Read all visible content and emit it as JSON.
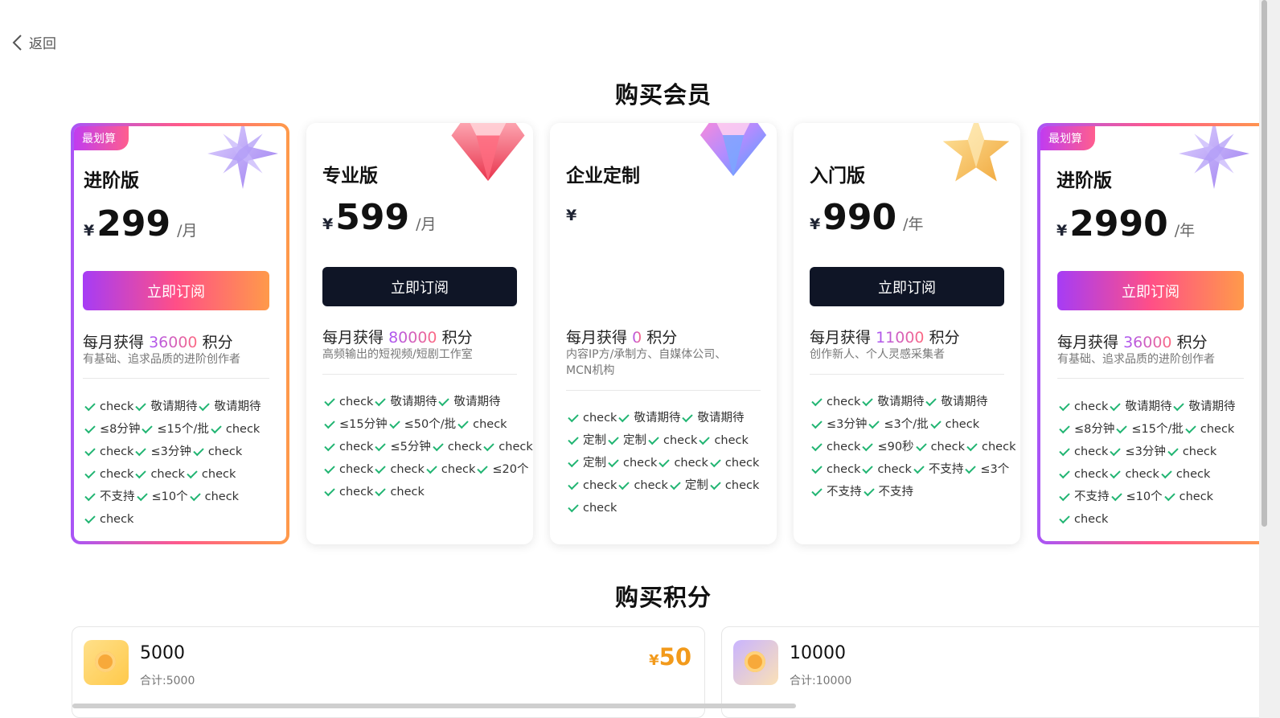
{
  "nav": {
    "back_label": "返回"
  },
  "membership": {
    "title": "购买会员",
    "plans": [
      {
        "tag": "最划算",
        "name": "进阶版",
        "currency": "¥",
        "amount": "299",
        "period": "/月",
        "button_label": "立即订阅",
        "credits_prefix": "每月获得",
        "credits": "36000",
        "credits_suffix": "积分",
        "description": [
          "有基础、追求品质的进阶创作者"
        ],
        "features": [
          [
            "check",
            "敬请期待",
            "敬请期待"
          ],
          [
            "≤8分钟",
            "≤15个/批",
            "check"
          ],
          [
            "check",
            "≤3分钟",
            "check"
          ],
          [
            "check",
            "check",
            "check"
          ],
          [
            "不支持",
            "≤10个",
            "check"
          ],
          [
            "check"
          ]
        ],
        "icon": "purple-star-icon",
        "highlight": true
      },
      {
        "name": "专业版",
        "currency": "¥",
        "amount": "599",
        "period": "/月",
        "button_label": "立即订阅",
        "credits_prefix": "每月获得",
        "credits": "80000",
        "credits_suffix": "积分",
        "description": [
          "高频输出的短视频/短剧工作室"
        ],
        "features": [
          [
            "check",
            "敬请期待",
            "敬请期待"
          ],
          [
            "≤15分钟",
            "≤50个/批",
            "check"
          ],
          [
            "check",
            "≤5分钟",
            "check",
            "check"
          ],
          [
            "check",
            "check",
            "check",
            "≤20个"
          ],
          [
            "check",
            "check"
          ]
        ],
        "icon": "red-gem-icon",
        "highlight": false
      },
      {
        "name": "企业定制",
        "currency": "¥",
        "amount": "",
        "period": "",
        "button_label": "",
        "credits_prefix": "每月获得",
        "credits": "0",
        "credits_suffix": "积分",
        "description": [
          "内容IP方/承制方、自媒体公司、",
          "MCN机构"
        ],
        "features": [
          [
            "check",
            "敬请期待",
            "敬请期待"
          ],
          [
            "定制",
            "定制",
            "check",
            "check"
          ],
          [
            "定制",
            "check",
            "check",
            "check"
          ],
          [
            "check",
            "check",
            "定制",
            "check"
          ],
          [
            "check"
          ]
        ],
        "icon": "blue-gem-icon",
        "highlight": false
      },
      {
        "name": "入门版",
        "currency": "¥",
        "amount": "990",
        "period": "/年",
        "button_label": "立即订阅",
        "credits_prefix": "每月获得",
        "credits": "11000",
        "credits_suffix": "积分",
        "description": [
          "创作新人、个人灵感采集者"
        ],
        "features": [
          [
            "check",
            "敬请期待",
            "敬请期待"
          ],
          [
            "≤3分钟",
            "≤3个/批",
            "check"
          ],
          [
            "check",
            "≤90秒",
            "check",
            "check"
          ],
          [
            "check",
            "check",
            "不支持",
            "≤3个"
          ],
          [
            "不支持",
            "不支持"
          ]
        ],
        "icon": "gold-star-icon",
        "highlight": false
      },
      {
        "tag": "最划算",
        "name": "进阶版",
        "currency": "¥",
        "amount": "2990",
        "period": "/年",
        "button_label": "立即订阅",
        "credits_prefix": "每月获得",
        "credits": "36000",
        "credits_suffix": "积分",
        "description": [
          "有基础、追求品质的进阶创作者"
        ],
        "features": [
          [
            "check",
            "敬请期待",
            "敬请期待"
          ],
          [
            "≤8分钟",
            "≤15个/批",
            "check"
          ],
          [
            "check",
            "≤3分钟",
            "check"
          ],
          [
            "check",
            "check",
            "check"
          ],
          [
            "不支持",
            "≤10个",
            "check"
          ],
          [
            "check"
          ]
        ],
        "icon": "purple-star-icon",
        "highlight": true
      }
    ]
  },
  "credits_section": {
    "title": "购买积分",
    "packages": [
      {
        "amount": "5000",
        "total": "合计:5000",
        "currency": "¥",
        "price": "50",
        "icon": "gold-coin-icon"
      },
      {
        "amount": "10000",
        "total": "合计:10000",
        "currency": "",
        "price": "",
        "icon": "purple-coin-icon"
      }
    ]
  },
  "colors": {
    "accent_gradient_start": "#a855f7",
    "accent_gradient_end": "#ff9a4a",
    "dark_button": "#0f1526",
    "check_green": "#22b573",
    "price_orange": "#f29a1b"
  }
}
